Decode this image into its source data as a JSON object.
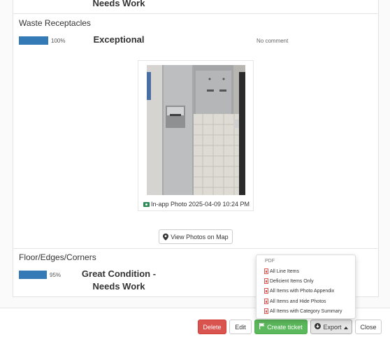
{
  "sections": [
    {
      "rating_lines": [
        "Needs Work"
      ]
    },
    {
      "title": "Waste Receptacles",
      "percent": 100,
      "percent_label": "100%",
      "rating": "Exceptional",
      "comment": "No comment",
      "photo_caption": "In-app Photo 2025-04-09 10:24 PM",
      "map_button": "View Photos on Map"
    },
    {
      "title": "Floor/Edges/Corners",
      "percent": 95,
      "percent_label": "95%",
      "rating_lines": [
        "Great Condition -",
        "Needs Work"
      ]
    }
  ],
  "colors": {
    "bar": "#337ab7",
    "delete": "#d9534f",
    "ticket": "#5cb85c"
  },
  "footer": {
    "delete": "Delete",
    "edit": "Edit",
    "create_ticket": "Create ticket",
    "export": "Export",
    "close": "Close"
  },
  "export_menu": {
    "header": "PDF",
    "items": [
      "All Line Items",
      "Deficient Items Only",
      "All Items with Photo Appendix",
      "All Items and Hide Photos",
      "All Items with Category Summary"
    ]
  }
}
